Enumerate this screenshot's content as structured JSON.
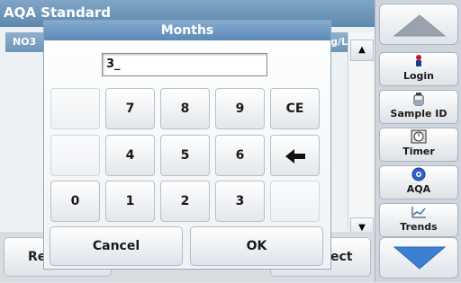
{
  "app": {
    "window_title": "AQA Standard"
  },
  "background": {
    "column_1": "NO3",
    "column_2": "g/L",
    "bottom_left_label": "Re",
    "bottom_right_label": "ect",
    "scroll_up_symbol": "▲",
    "scroll_down_symbol": "▼"
  },
  "dialog": {
    "title": "Months",
    "input_value": "3_",
    "keys": {
      "k7": "7",
      "k8": "8",
      "k9": "9",
      "ce": "CE",
      "k4": "4",
      "k5": "5",
      "k6": "6",
      "backspace": "🡐",
      "k0": "0",
      "k1": "1",
      "k2": "2",
      "k3": "3"
    },
    "cancel_label": "Cancel",
    "ok_label": "OK"
  },
  "sidebar": {
    "login_label": "Login",
    "login_icon": "person-icon",
    "sample_id_label": "Sample ID",
    "sample_id_icon": "sample-bottle-icon",
    "timer_label": "Timer",
    "timer_icon": "timer-icon",
    "aqa_label": "AQA",
    "aqa_icon": "aqa-icon",
    "trends_label": "Trends",
    "trends_icon": "trend-chart-icon"
  },
  "colors": {
    "title_bar": "#5b8ab6",
    "accent_blue": "#3d7fd1"
  }
}
